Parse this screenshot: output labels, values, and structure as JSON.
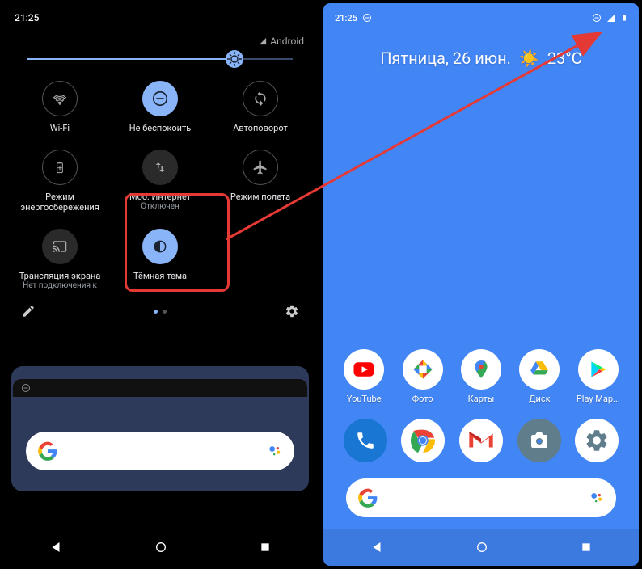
{
  "left": {
    "time": "21:25",
    "carrier": "Android",
    "tiles": [
      {
        "name": "wifi",
        "label": "Wi-Fi",
        "sub": ""
      },
      {
        "name": "dnd",
        "label": "Не беспокоить",
        "sub": ""
      },
      {
        "name": "autorotate",
        "label": "Автоповорот",
        "sub": ""
      },
      {
        "name": "battery",
        "label": "Режим энергосбережения",
        "sub": ""
      },
      {
        "name": "mobiledata",
        "label": "Моб. Интернет",
        "sub": "Отключен"
      },
      {
        "name": "airplane",
        "label": "Режим полета",
        "sub": ""
      },
      {
        "name": "cast",
        "label": "Трансляция экрана",
        "sub": "Нет подключения к"
      },
      {
        "name": "darktheme",
        "label": "Тёмная тема",
        "sub": ""
      }
    ]
  },
  "right": {
    "time": "21:25",
    "date": "Пятница, 26 июн.",
    "temp": "23°C",
    "apps": [
      {
        "name": "youtube",
        "label": "YouTube"
      },
      {
        "name": "photos",
        "label": "Фото"
      },
      {
        "name": "maps",
        "label": "Карты"
      },
      {
        "name": "drive",
        "label": "Диск"
      },
      {
        "name": "playstore",
        "label": "Play Мар..."
      }
    ],
    "dock": [
      {
        "name": "phone"
      },
      {
        "name": "chrome"
      },
      {
        "name": "gmail"
      },
      {
        "name": "camera"
      },
      {
        "name": "settings"
      }
    ]
  }
}
